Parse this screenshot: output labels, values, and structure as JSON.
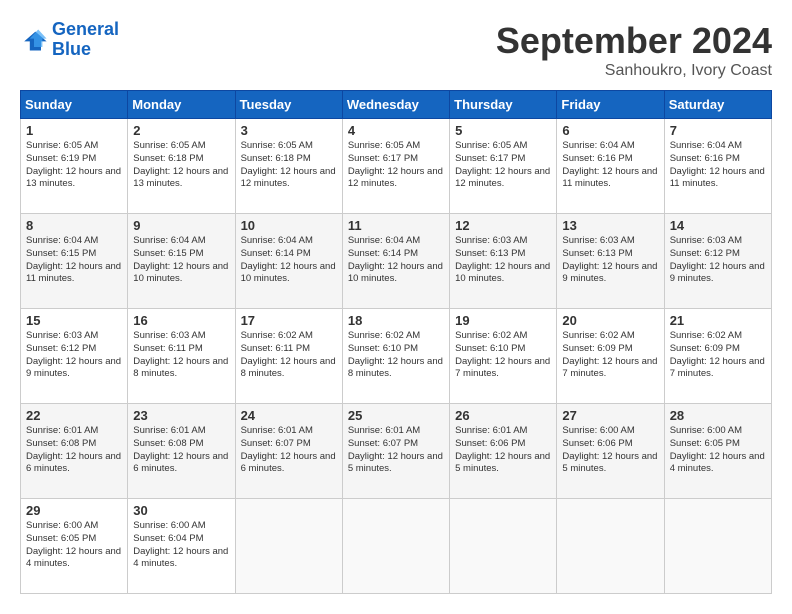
{
  "header": {
    "logo_line1": "General",
    "logo_line2": "Blue",
    "month_title": "September 2024",
    "location": "Sanhoukro, Ivory Coast"
  },
  "weekdays": [
    "Sunday",
    "Monday",
    "Tuesday",
    "Wednesday",
    "Thursday",
    "Friday",
    "Saturday"
  ],
  "weeks": [
    [
      {
        "day": "1",
        "info": "Sunrise: 6:05 AM\nSunset: 6:19 PM\nDaylight: 12 hours and 13 minutes."
      },
      {
        "day": "2",
        "info": "Sunrise: 6:05 AM\nSunset: 6:18 PM\nDaylight: 12 hours and 13 minutes."
      },
      {
        "day": "3",
        "info": "Sunrise: 6:05 AM\nSunset: 6:18 PM\nDaylight: 12 hours and 12 minutes."
      },
      {
        "day": "4",
        "info": "Sunrise: 6:05 AM\nSunset: 6:17 PM\nDaylight: 12 hours and 12 minutes."
      },
      {
        "day": "5",
        "info": "Sunrise: 6:05 AM\nSunset: 6:17 PM\nDaylight: 12 hours and 12 minutes."
      },
      {
        "day": "6",
        "info": "Sunrise: 6:04 AM\nSunset: 6:16 PM\nDaylight: 12 hours and 11 minutes."
      },
      {
        "day": "7",
        "info": "Sunrise: 6:04 AM\nSunset: 6:16 PM\nDaylight: 12 hours and 11 minutes."
      }
    ],
    [
      {
        "day": "8",
        "info": "Sunrise: 6:04 AM\nSunset: 6:15 PM\nDaylight: 12 hours and 11 minutes."
      },
      {
        "day": "9",
        "info": "Sunrise: 6:04 AM\nSunset: 6:15 PM\nDaylight: 12 hours and 10 minutes."
      },
      {
        "day": "10",
        "info": "Sunrise: 6:04 AM\nSunset: 6:14 PM\nDaylight: 12 hours and 10 minutes."
      },
      {
        "day": "11",
        "info": "Sunrise: 6:04 AM\nSunset: 6:14 PM\nDaylight: 12 hours and 10 minutes."
      },
      {
        "day": "12",
        "info": "Sunrise: 6:03 AM\nSunset: 6:13 PM\nDaylight: 12 hours and 10 minutes."
      },
      {
        "day": "13",
        "info": "Sunrise: 6:03 AM\nSunset: 6:13 PM\nDaylight: 12 hours and 9 minutes."
      },
      {
        "day": "14",
        "info": "Sunrise: 6:03 AM\nSunset: 6:12 PM\nDaylight: 12 hours and 9 minutes."
      }
    ],
    [
      {
        "day": "15",
        "info": "Sunrise: 6:03 AM\nSunset: 6:12 PM\nDaylight: 12 hours and 9 minutes."
      },
      {
        "day": "16",
        "info": "Sunrise: 6:03 AM\nSunset: 6:11 PM\nDaylight: 12 hours and 8 minutes."
      },
      {
        "day": "17",
        "info": "Sunrise: 6:02 AM\nSunset: 6:11 PM\nDaylight: 12 hours and 8 minutes."
      },
      {
        "day": "18",
        "info": "Sunrise: 6:02 AM\nSunset: 6:10 PM\nDaylight: 12 hours and 8 minutes."
      },
      {
        "day": "19",
        "info": "Sunrise: 6:02 AM\nSunset: 6:10 PM\nDaylight: 12 hours and 7 minutes."
      },
      {
        "day": "20",
        "info": "Sunrise: 6:02 AM\nSunset: 6:09 PM\nDaylight: 12 hours and 7 minutes."
      },
      {
        "day": "21",
        "info": "Sunrise: 6:02 AM\nSunset: 6:09 PM\nDaylight: 12 hours and 7 minutes."
      }
    ],
    [
      {
        "day": "22",
        "info": "Sunrise: 6:01 AM\nSunset: 6:08 PM\nDaylight: 12 hours and 6 minutes."
      },
      {
        "day": "23",
        "info": "Sunrise: 6:01 AM\nSunset: 6:08 PM\nDaylight: 12 hours and 6 minutes."
      },
      {
        "day": "24",
        "info": "Sunrise: 6:01 AM\nSunset: 6:07 PM\nDaylight: 12 hours and 6 minutes."
      },
      {
        "day": "25",
        "info": "Sunrise: 6:01 AM\nSunset: 6:07 PM\nDaylight: 12 hours and 5 minutes."
      },
      {
        "day": "26",
        "info": "Sunrise: 6:01 AM\nSunset: 6:06 PM\nDaylight: 12 hours and 5 minutes."
      },
      {
        "day": "27",
        "info": "Sunrise: 6:00 AM\nSunset: 6:06 PM\nDaylight: 12 hours and 5 minutes."
      },
      {
        "day": "28",
        "info": "Sunrise: 6:00 AM\nSunset: 6:05 PM\nDaylight: 12 hours and 4 minutes."
      }
    ],
    [
      {
        "day": "29",
        "info": "Sunrise: 6:00 AM\nSunset: 6:05 PM\nDaylight: 12 hours and 4 minutes."
      },
      {
        "day": "30",
        "info": "Sunrise: 6:00 AM\nSunset: 6:04 PM\nDaylight: 12 hours and 4 minutes."
      },
      {
        "day": "",
        "info": ""
      },
      {
        "day": "",
        "info": ""
      },
      {
        "day": "",
        "info": ""
      },
      {
        "day": "",
        "info": ""
      },
      {
        "day": "",
        "info": ""
      }
    ]
  ]
}
